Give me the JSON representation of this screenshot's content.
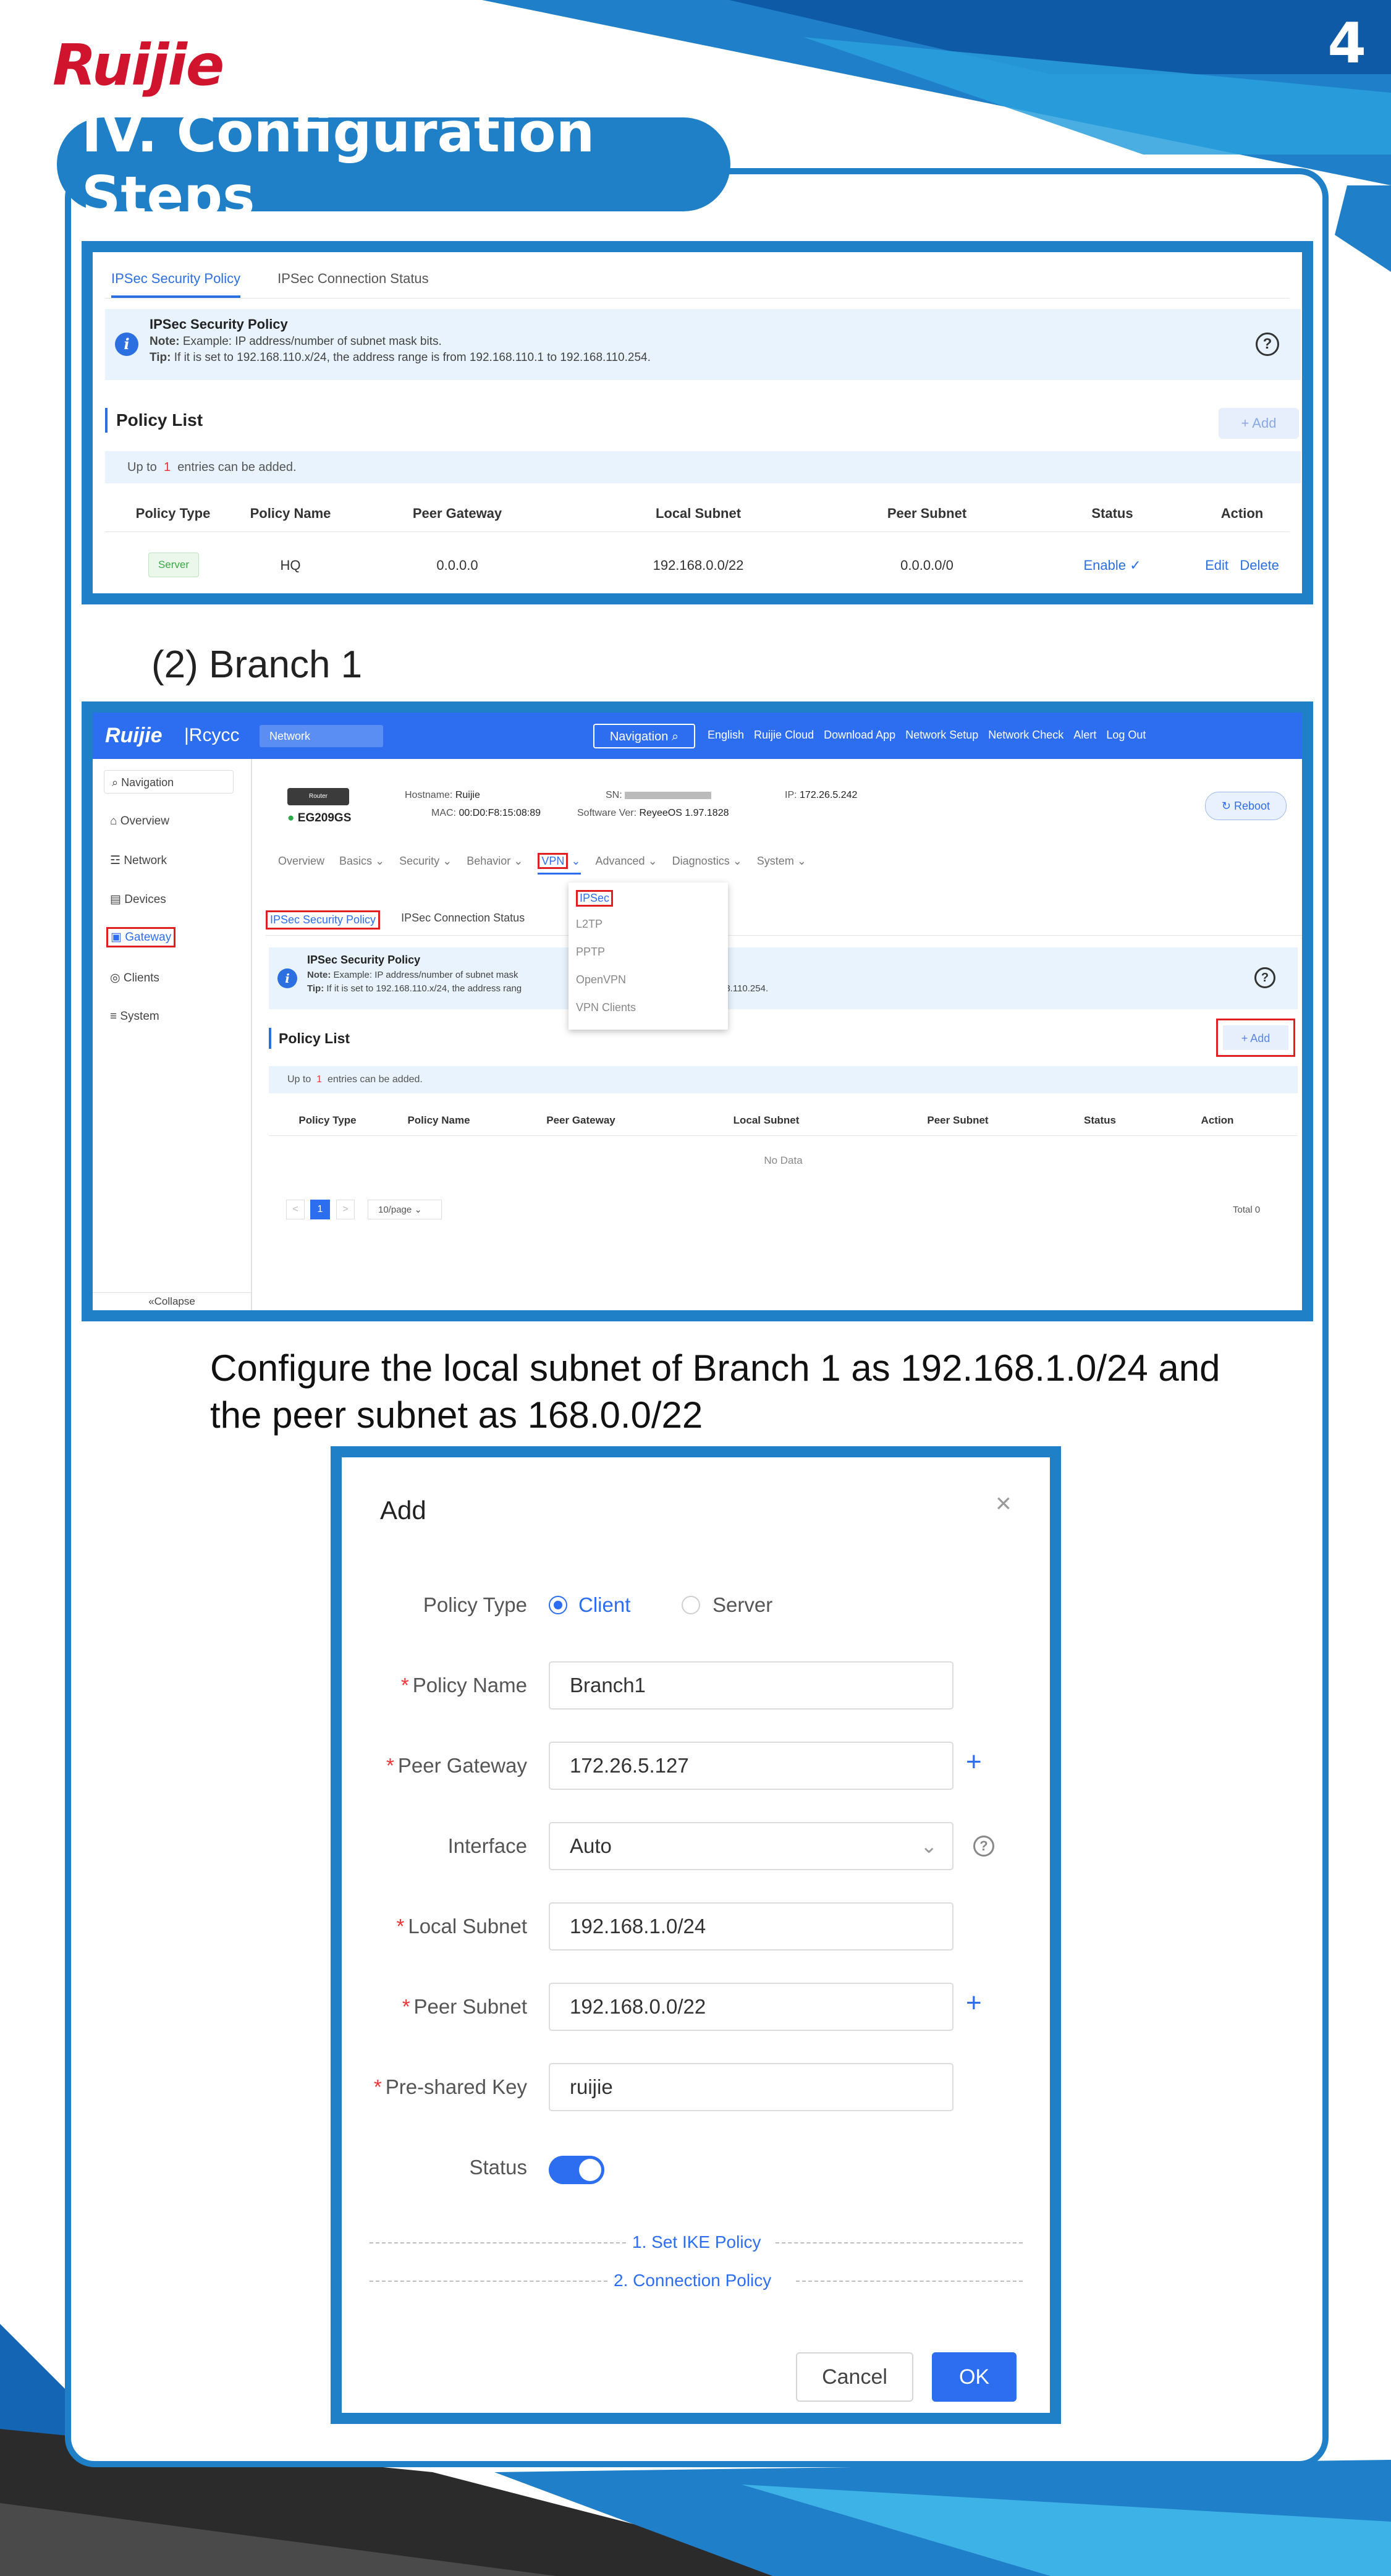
{
  "brand": {
    "logo_text": "Ruijie",
    "page_number": "4",
    "colors": {
      "primary": "#1f80c8",
      "accent": "#2b6fe0",
      "logo_red": "#d0142d"
    }
  },
  "section_title": "IV. Configuration Steps",
  "screenshot1": {
    "tabs": [
      "IPSec Security Policy",
      "IPSec Connection Status"
    ],
    "note_title": "IPSec Security Policy",
    "note_line1_label": "Note:",
    "note_line1": "Example: IP address/number of subnet mask bits.",
    "note_line2_label": "Tip:",
    "note_line2": "If it is set to 192.168.110.x/24, the address range is from 192.168.110.1 to 192.168.110.254.",
    "policy_list_title": "Policy List",
    "add_label": "+ Add",
    "upto_prefix": "Up to",
    "upto_count": "1",
    "upto_suffix": "entries can be added.",
    "columns": [
      "Policy Type",
      "Policy Name",
      "Peer Gateway",
      "Local Subnet",
      "Peer Subnet",
      "Status",
      "Action"
    ],
    "row": {
      "type": "Server",
      "name": "HQ",
      "peer_gateway": "0.0.0.0",
      "local_subnet": "192.168.0.0/22",
      "peer_subnet": "0.0.0.0/0",
      "status": "Enable",
      "edit": "Edit",
      "delete": "Delete"
    }
  },
  "branch_heading": "(2) Branch 1",
  "screenshot2": {
    "topbar": {
      "logo": "Ruijie",
      "product": "Rcycc",
      "network_select": "Network",
      "navigation_btn": "Navigation",
      "items": [
        "English",
        "Ruijie Cloud",
        "Download App",
        "Network Setup",
        "Network Check",
        "Alert",
        "Log Out"
      ]
    },
    "sidebar": {
      "search_placeholder": "Navigation",
      "items": [
        "Overview",
        "Network",
        "Devices",
        "Gateway",
        "Clients",
        "System"
      ],
      "collapse": "Collapse"
    },
    "device": {
      "icon_label": "Router",
      "model": "EG209GS",
      "hostname_label": "Hostname:",
      "hostname": "Ruijie",
      "sn_label": "SN:",
      "ip_label": "IP:",
      "ip": "172.26.5.242",
      "mac_label": "MAC:",
      "mac": "00:D0:F8:15:08:89",
      "sw_label": "Software Ver:",
      "sw": "ReyeeOS 1.97.1828",
      "reboot": "Reboot"
    },
    "menu": [
      "Overview",
      "Basics",
      "Security",
      "Behavior",
      "VPN",
      "Advanced",
      "Diagnostics",
      "System"
    ],
    "vpn_dropdown": [
      "IPSec",
      "L2TP",
      "PPTP",
      "OpenVPN",
      "VPN Clients"
    ],
    "tabs": [
      "IPSec Security Policy",
      "IPSec Connection Status"
    ],
    "note_title": "IPSec Security Policy",
    "note_line1_label": "Note:",
    "note_line1": "Example: IP address/number of subnet mask",
    "note_line2_label": "Tip:",
    "note_line2": "If it is set to 192.168.110.x/24, the address rang",
    "note_tail": "68.110.254.",
    "policy_list_title": "Policy List",
    "add_label": "+ Add",
    "upto_prefix": "Up to",
    "upto_count": "1",
    "upto_suffix": "entries can be added.",
    "columns": [
      "Policy Type",
      "Policy Name",
      "Peer Gateway",
      "Local Subnet",
      "Peer Subnet",
      "Status",
      "Action"
    ],
    "no_data": "No Data",
    "pager": {
      "page": "1",
      "per_page": "10/page",
      "total": "Total 0"
    }
  },
  "description_line1": "Configure the local subnet of Branch 1 as 192.168.1.0/24 and",
  "description_line2": "the peer subnet as 168.0.0/22",
  "dialog": {
    "title": "Add",
    "policy_type_label": "Policy Type",
    "policy_type_options": [
      "Client",
      "Server"
    ],
    "policy_type_selected": "Client",
    "fields": {
      "policy_name": {
        "label": "Policy Name",
        "value": "Branch1"
      },
      "peer_gateway": {
        "label": "Peer Gateway",
        "value": "172.26.5.127"
      },
      "interface": {
        "label": "Interface",
        "value": "Auto"
      },
      "local_subnet": {
        "label": "Local Subnet",
        "value": "192.168.1.0/24"
      },
      "peer_subnet": {
        "label": "Peer Subnet",
        "value": "192.168.0.0/22"
      },
      "psk": {
        "label": "Pre-shared Key",
        "value": "ruijie"
      }
    },
    "status_label": "Status",
    "status_on": true,
    "links": [
      "1. Set IKE Policy",
      "2. Connection Policy"
    ],
    "cancel": "Cancel",
    "ok": "OK"
  }
}
